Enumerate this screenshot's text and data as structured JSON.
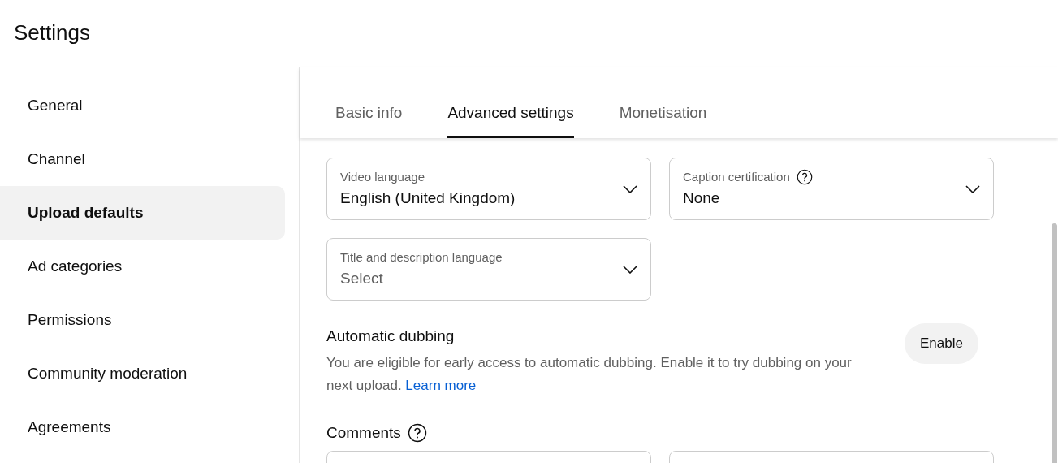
{
  "header": {
    "title": "Settings"
  },
  "sidebar": {
    "items": [
      {
        "label": "General",
        "selected": false
      },
      {
        "label": "Channel",
        "selected": false
      },
      {
        "label": "Upload defaults",
        "selected": true
      },
      {
        "label": "Ad categories",
        "selected": false
      },
      {
        "label": "Permissions",
        "selected": false
      },
      {
        "label": "Community moderation",
        "selected": false
      },
      {
        "label": "Agreements",
        "selected": false
      }
    ]
  },
  "tabs": [
    {
      "label": "Basic info",
      "selected": false
    },
    {
      "label": "Advanced settings",
      "selected": true
    },
    {
      "label": "Monetisation",
      "selected": false
    }
  ],
  "language_section": {
    "fields": [
      {
        "label": "Video language",
        "value": "English (United Kingdom)",
        "help": false
      },
      {
        "label": "Caption certification",
        "value": "None",
        "help": true
      },
      {
        "label": "Title and description language",
        "placeholder": "Select",
        "help": false
      }
    ]
  },
  "dubbing": {
    "title": "Automatic dubbing",
    "text": "You are eligible for early access to automatic dubbing. Enable it to try dubbing on your next upload.",
    "link": "Learn more",
    "button": "Enable"
  },
  "comments": {
    "title": "Comments",
    "help": true
  }
}
